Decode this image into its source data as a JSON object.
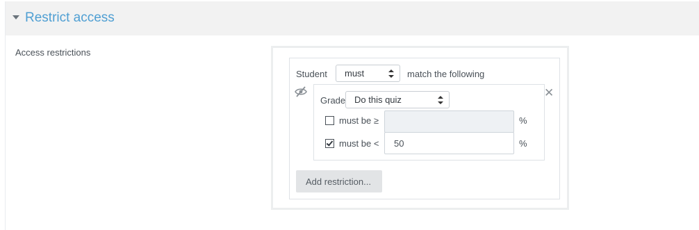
{
  "section": {
    "title": "Restrict access"
  },
  "access": {
    "label": "Access restrictions",
    "student_label": "Student",
    "match_select": "must",
    "match_text": "match the following",
    "condition": {
      "type_label": "Grade",
      "item_select": "Do this quiz",
      "min": {
        "label": "must be ≥",
        "checked": false,
        "value": "",
        "unit": "%"
      },
      "max": {
        "label": "must be <",
        "checked": true,
        "value": "50",
        "unit": "%"
      },
      "delete_glyph": "✕"
    },
    "add_button": "Add restriction..."
  },
  "icons": {
    "caret": "caret-down-icon",
    "eye": "eye-slash-icon",
    "close": "close-icon"
  },
  "colors": {
    "section_title": "#4f9fd3",
    "header_bg": "#f2f2f2",
    "disabled_field": "#eef1f4",
    "button_bg": "#e2e4e6"
  }
}
